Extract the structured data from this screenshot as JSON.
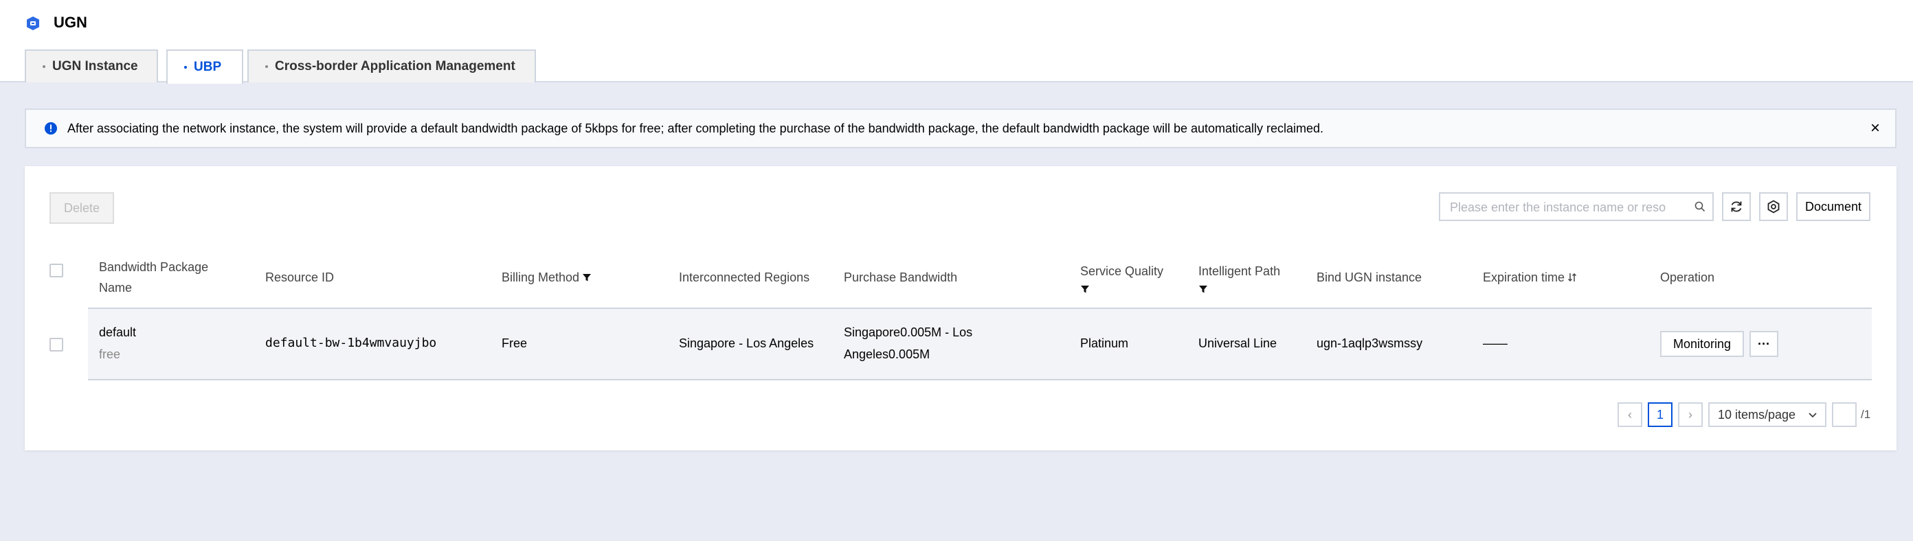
{
  "app": {
    "title": "UGN"
  },
  "tabs": [
    {
      "label": "UGN Instance",
      "active": false
    },
    {
      "label": "UBP",
      "active": true
    },
    {
      "label": "Cross-border Application Management",
      "active": false
    }
  ],
  "alert": {
    "text": "After associating the network instance, the system will provide a default bandwidth package of 5kbps for free; after completing the purchase of the bandwidth package, the default bandwidth package will be automatically reclaimed.",
    "close": "×"
  },
  "toolbar": {
    "delete_label": "Delete",
    "search_placeholder": "Please enter the instance name or reso",
    "document_label": "Document"
  },
  "table": {
    "headers": {
      "name_line1": "Bandwidth Package",
      "name_line2": "Name",
      "resource_id": "Resource ID",
      "billing_method": "Billing Method",
      "regions": "Interconnected Regions",
      "purchase_bandwidth": "Purchase Bandwidth",
      "service_quality": "Service Quality",
      "intelligent_path": "Intelligent Path",
      "bind_ugn": "Bind UGN instance",
      "expiration": "Expiration time",
      "operation": "Operation"
    },
    "rows": [
      {
        "name": "default",
        "name_sub": "free",
        "resource_id": "default-bw-1b4wmvauyjbo",
        "billing_method": "Free",
        "regions": "Singapore - Los Angeles",
        "bandwidth_line1": "Singapore0.005M - Los",
        "bandwidth_line2": "Angeles0.005M",
        "service_quality": "Platinum",
        "intelligent_path": "Universal Line",
        "bind_ugn": "ugn-1aqlp3wsmssy",
        "expiration": "——",
        "monitoring_label": "Monitoring",
        "more_label": "···"
      }
    ]
  },
  "pagination": {
    "prev": "‹",
    "current_page": "1",
    "next": "›",
    "page_size": "10 items/page",
    "page_input": "",
    "total_pages": "/1"
  },
  "colors": {
    "accent": "#0052d9",
    "background": "#e8ebf4"
  }
}
